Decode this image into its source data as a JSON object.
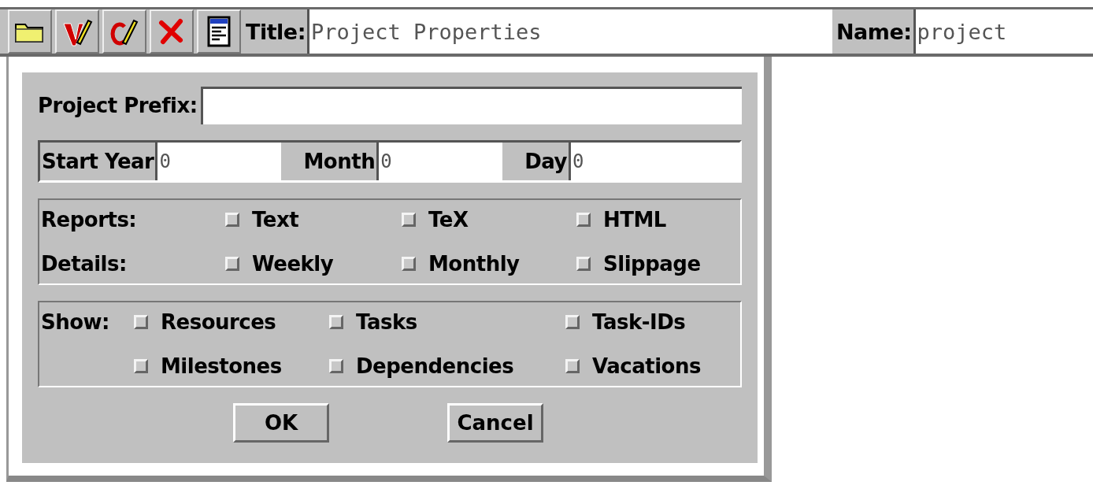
{
  "toolbar": {
    "buttons": [
      {
        "kind": "folder"
      },
      {
        "kind": "check-v"
      },
      {
        "kind": "check-c"
      },
      {
        "kind": "delete"
      },
      {
        "kind": "document"
      }
    ],
    "title": {
      "label": "Title:",
      "value": "Project Properties"
    },
    "name": {
      "label": "Name:",
      "value": "project"
    }
  },
  "dialog": {
    "prefix": {
      "label": "Project Prefix:"
    },
    "date": [
      {
        "label": "Start Year",
        "value": "0"
      },
      {
        "label": "Month",
        "value": "0"
      },
      {
        "label": "Day",
        "value": "0"
      }
    ],
    "reports": [
      {
        "label": "Reports:",
        "options": [
          {
            "label": "Text",
            "checked": false
          },
          {
            "label": "TeX",
            "checked": false
          },
          {
            "label": "HTML",
            "checked": false
          }
        ]
      },
      {
        "label": "Details:",
        "options": [
          {
            "label": "Weekly",
            "checked": false
          },
          {
            "label": "Monthly",
            "checked": false
          },
          {
            "label": "Slippage",
            "checked": false
          }
        ]
      }
    ],
    "show": {
      "label": "Show:",
      "options": [
        {
          "label": "Resources",
          "checked": false
        },
        {
          "label": "Tasks",
          "checked": false
        },
        {
          "label": "Task-IDs",
          "checked": false
        },
        {
          "label": "Milestones",
          "checked": false
        },
        {
          "label": "Dependencies",
          "checked": false
        },
        {
          "label": "Vacations",
          "checked": false
        }
      ]
    },
    "buttons": [
      "OK",
      "Cancel"
    ]
  }
}
